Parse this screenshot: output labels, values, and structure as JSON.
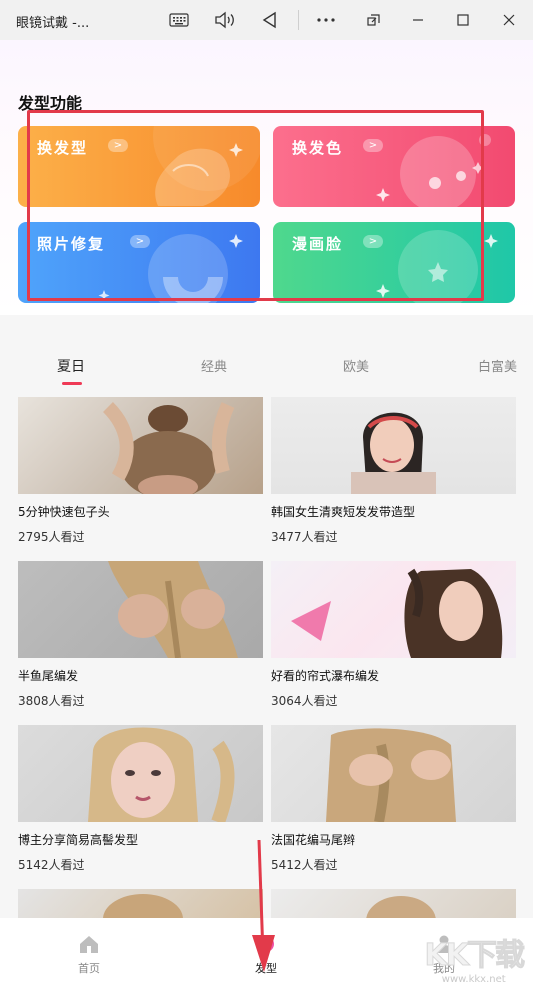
{
  "window": {
    "title": "眼镜试戴 -...",
    "icons": [
      "keyboard-icon",
      "speaker-icon",
      "back-triangle-icon",
      "more-icon",
      "restore-overlay-icon",
      "minimize-icon",
      "maximize-icon",
      "close-icon"
    ]
  },
  "features": {
    "heading": "发型功能",
    "cards": [
      {
        "label": "换发型",
        "arrow": ">",
        "color": "#f78a2b"
      },
      {
        "label": "换发色",
        "arrow": ">",
        "color": "#f24a70"
      },
      {
        "label": "照片修复",
        "arrow": ">",
        "color": "#3d78f0"
      },
      {
        "label": "漫画脸",
        "arrow": ">",
        "color": "#1fc7a8"
      }
    ]
  },
  "tabs": [
    {
      "label": "夏日",
      "active": true
    },
    {
      "label": "经典",
      "active": false
    },
    {
      "label": "欧美",
      "active": false
    },
    {
      "label": "白富美",
      "active": false
    }
  ],
  "items": [
    {
      "title": "5分钟快速包子头",
      "views": "2795人看过"
    },
    {
      "title": "韩国女生清爽短发发带造型",
      "views": "3477人看过"
    },
    {
      "title": "半鱼尾编发",
      "views": "3808人看过"
    },
    {
      "title": "好看的帘式瀑布编发",
      "views": "3064人看过"
    },
    {
      "title": "博主分享简易高髻发型",
      "views": "5142人看过"
    },
    {
      "title": "法国花编马尾辫",
      "views": "5412人看过"
    }
  ],
  "nav": {
    "home": {
      "label": "首页",
      "icon": "home-icon"
    },
    "hair": {
      "label": "发型",
      "icon": "hair-icon"
    },
    "mine": {
      "label": "我的",
      "icon": "profile-icon"
    }
  },
  "watermark": {
    "big": "KK下载",
    "small": "www.kkx.net"
  },
  "colors": {
    "accent": "#ef3a56",
    "annotation": "#e23a4a"
  }
}
